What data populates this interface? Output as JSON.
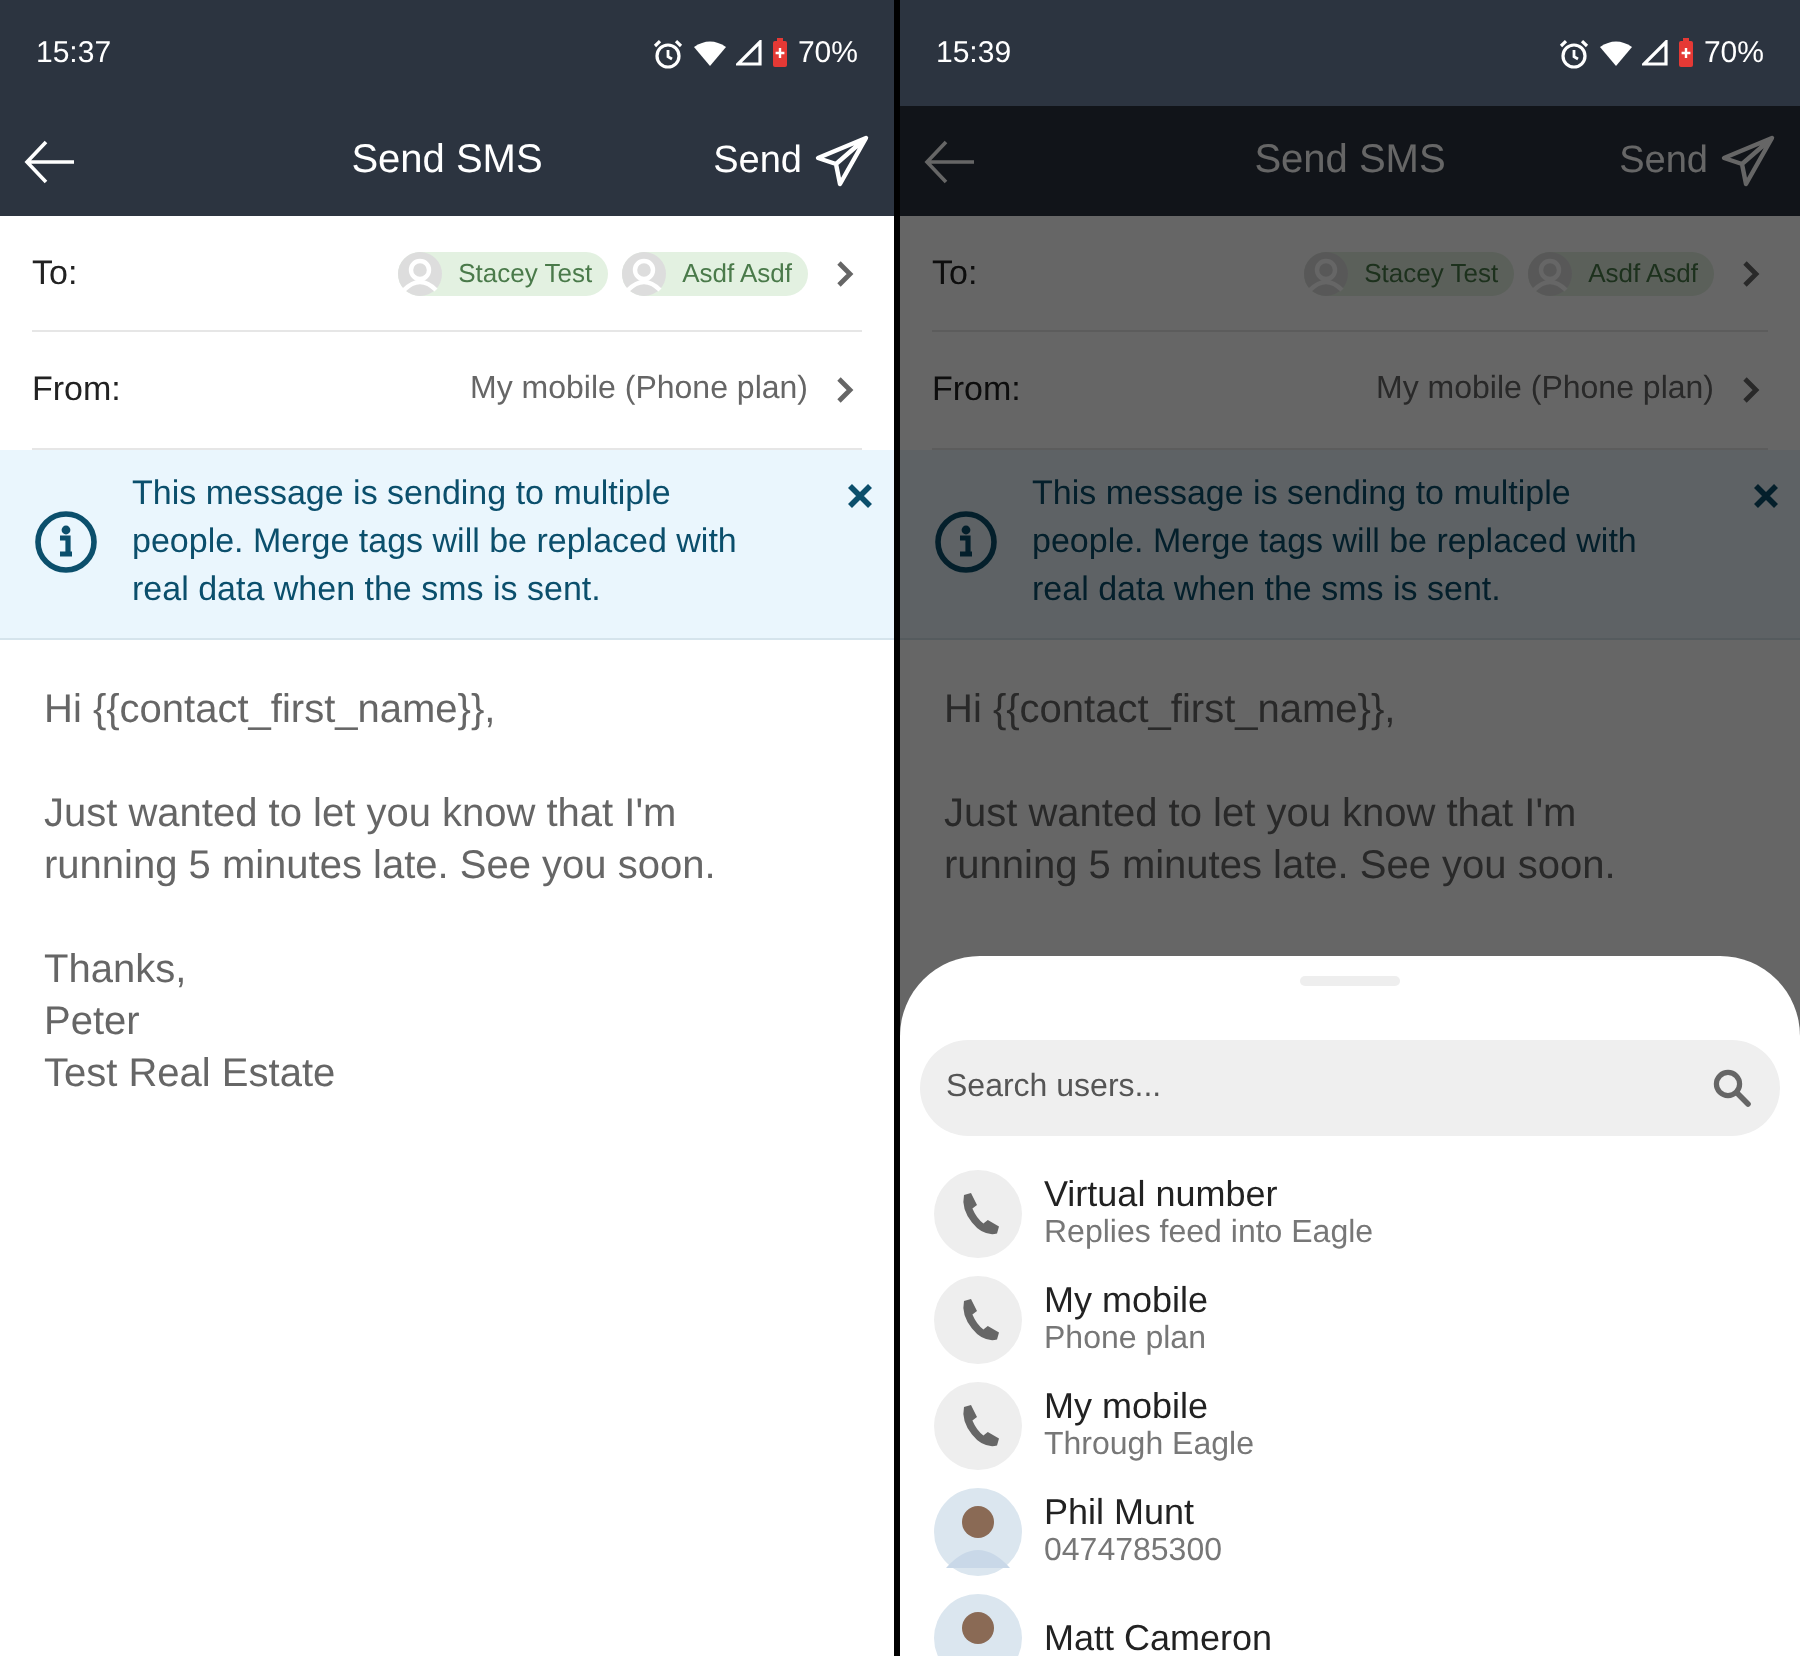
{
  "screens": [
    {
      "status_bar": {
        "time": "15:37",
        "battery": "70%"
      },
      "app_bar": {
        "title": "Send SMS",
        "action": "Send"
      },
      "to": {
        "label": "To:",
        "recipients": [
          "Stacey Test",
          "Asdf Asdf"
        ]
      },
      "from": {
        "label": "From:",
        "value": "My mobile (Phone plan)"
      },
      "banner": {
        "text": "This message is sending to multiple people. Merge tags will be replaced with real data when the sms is sent."
      },
      "message": {
        "paragraphs": [
          [
            "Hi {{contact_first_name}},"
          ],
          [
            "Just wanted to let you know that I'm running 5 minutes late. See you soon."
          ],
          [
            "Thanks,",
            "Peter",
            "Test Real Estate"
          ]
        ]
      },
      "dimmed": false
    },
    {
      "status_bar": {
        "time": "15:39",
        "battery": "70%"
      },
      "app_bar": {
        "title": "Send SMS",
        "action": "Send"
      },
      "to": {
        "label": "To:",
        "recipients": [
          "Stacey Test",
          "Asdf Asdf"
        ]
      },
      "from": {
        "label": "From:",
        "value": "My mobile (Phone plan)"
      },
      "banner": {
        "text": "This message is sending to multiple people. Merge tags will be replaced with real data when the sms is sent."
      },
      "message": {
        "paragraphs": [
          [
            "Hi {{contact_first_name}},"
          ],
          [
            "Just wanted to let you know that I'm running 5 minutes late. See you soon."
          ]
        ]
      },
      "dimmed": true,
      "bottom_sheet": {
        "search": {
          "placeholder": "Search users..."
        },
        "items": [
          {
            "kind": "phone",
            "title": "Virtual number",
            "subtitle": "Replies feed into Eagle"
          },
          {
            "kind": "phone",
            "title": "My mobile",
            "subtitle": "Phone plan"
          },
          {
            "kind": "phone",
            "title": "My mobile",
            "subtitle": "Through Eagle"
          },
          {
            "kind": "person",
            "title": "Phil Munt",
            "subtitle": "0474785300"
          },
          {
            "kind": "person",
            "title": "Matt Cameron"
          }
        ]
      }
    }
  ]
}
